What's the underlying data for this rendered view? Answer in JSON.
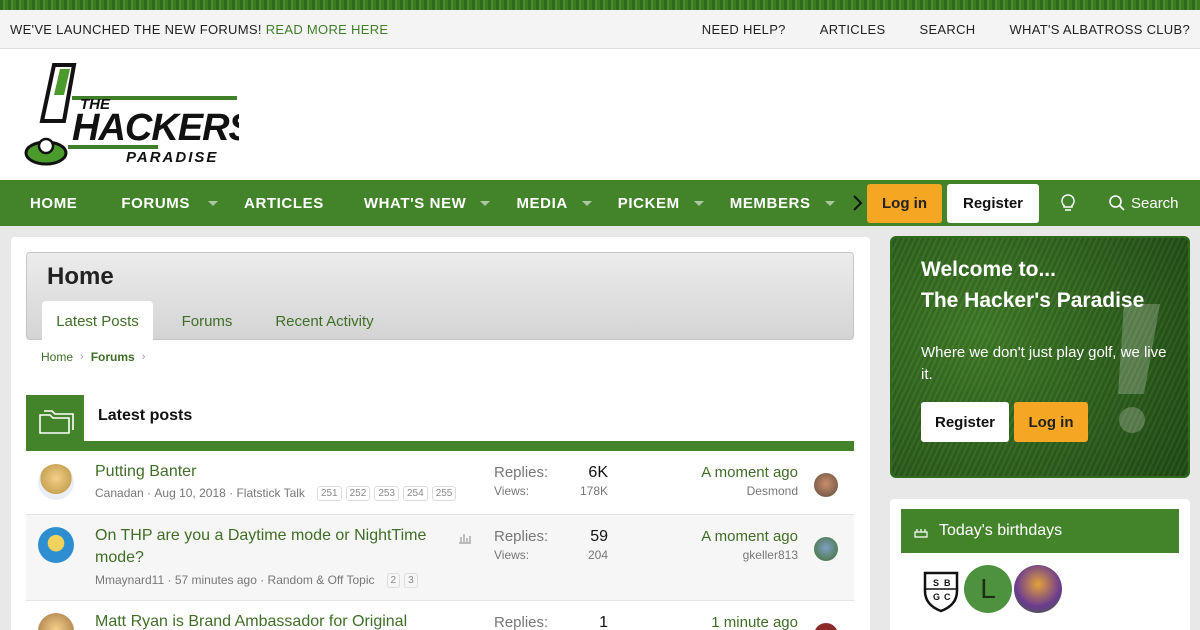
{
  "topbar": {
    "announcement": "WE'VE LAUNCHED THE NEW FORUMS!",
    "announcement_link": "READ MORE HERE",
    "links": [
      "NEED HELP?",
      "ARTICLES",
      "SEARCH",
      "WHAT'S ALBATROSS CLUB?"
    ]
  },
  "logo": {
    "line1": "THE",
    "line2": "HACKERS",
    "line3": "PARADISE"
  },
  "nav": {
    "items": [
      "HOME",
      "FORUMS",
      "ARTICLES",
      "WHAT'S NEW",
      "MEDIA",
      "PICKEM",
      "MEMBERS"
    ],
    "login": "Log in",
    "register": "Register",
    "search": "Search"
  },
  "page": {
    "title": "Home",
    "tabs": [
      "Latest Posts",
      "Forums",
      "Recent Activity"
    ],
    "breadcrumb": [
      "Home",
      "Forums"
    ],
    "block_title": "Latest posts"
  },
  "threads": [
    {
      "title": "Putting Banter",
      "author": "Canadan",
      "date": "Aug 10, 2018",
      "forum": "Flatstick Talk",
      "pages": [
        "251",
        "252",
        "253",
        "254",
        "255"
      ],
      "replies_label": "Replies:",
      "replies": "6K",
      "views_label": "Views:",
      "views": "178K",
      "last_time": "A moment ago",
      "last_user": "Desmond"
    },
    {
      "title_line1": "On THP are you a Daytime mode or NightTime",
      "title_line2": "mode?",
      "author": "Mmaynard11",
      "date": "57 minutes ago",
      "forum": "Random & Off Topic",
      "pages": [
        "2",
        "3"
      ],
      "replies_label": "Replies:",
      "replies": "59",
      "views_label": "Views:",
      "views": "204",
      "last_time": "A moment ago",
      "last_user": "gkeller813"
    },
    {
      "title": "Matt Ryan is Brand Ambassador for Original",
      "replies_label": "Replies:",
      "replies": "1",
      "last_time": "1 minute ago"
    }
  ],
  "welcome": {
    "line1": "Welcome to...",
    "line2": "The Hacker's Paradise",
    "text": "Where we don't just play golf, we live it.",
    "register": "Register",
    "login": "Log in"
  },
  "birthdays": {
    "title": "Today's birthdays",
    "crest_letters": [
      "S",
      "B",
      "G",
      "C"
    ],
    "avatar_letter": "L"
  },
  "colors": {
    "brand_green": "#43842b",
    "link_green": "#3f6e26",
    "login_orange": "#f5a623"
  },
  "icons": [
    "chevron-right-icon",
    "lightbulb-icon",
    "search-icon",
    "folders-icon",
    "poll-icon",
    "cake-icon"
  ]
}
